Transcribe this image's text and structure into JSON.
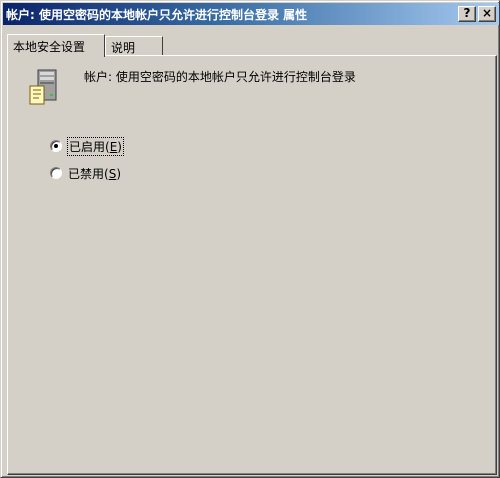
{
  "window": {
    "title": "帐户: 使用空密码的本地帐户只允许进行控制台登录 属性",
    "help_label": "?",
    "close_label": "×"
  },
  "tabs": [
    {
      "label": "本地安全设置"
    },
    {
      "label": "说明"
    }
  ],
  "policy": {
    "icon": "server-computer-icon",
    "title": "帐户: 使用空密码的本地帐户只允许进行控制台登录"
  },
  "options": {
    "enabled": {
      "prefix": "已启用(",
      "mnemonic": "E",
      "suffix": ")",
      "selected": true
    },
    "disabled": {
      "prefix": "已禁用(",
      "mnemonic": "S",
      "suffix": ")",
      "selected": false
    }
  },
  "colors": {
    "titlebar_start": "#0a246a",
    "titlebar_end": "#a6caf0",
    "face": "#d4d0c8"
  }
}
